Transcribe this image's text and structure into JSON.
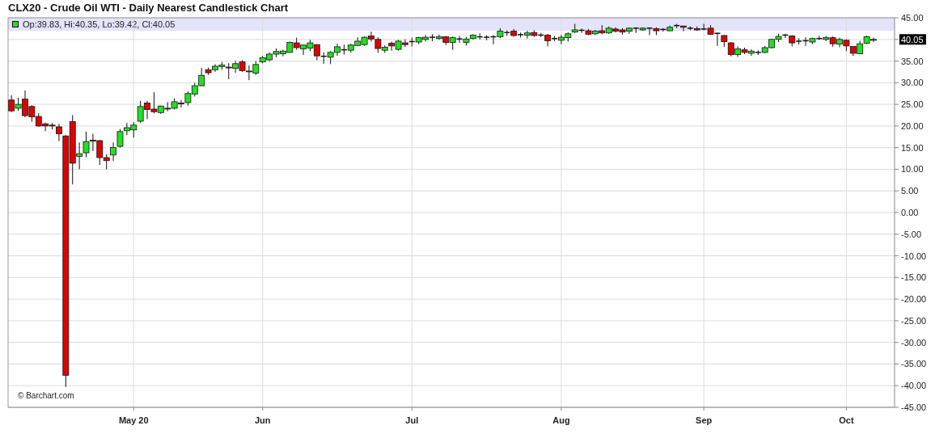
{
  "chart": {
    "title": "CLX20 - Crude Oil WTI - Daily Nearest Candlestick Chart",
    "legend": {
      "text": "Op:39.83, Hi:40.35, Lo:39.42, Cl:40.05"
    },
    "last_price_label": "40.05",
    "credit": "© Barchart.com",
    "chart_data": {
      "type": "candlestick",
      "grid": true,
      "ylim": [
        -45,
        45
      ],
      "yticks": [
        {
          "value": 45,
          "label": "45.00"
        },
        {
          "value": 35,
          "label": "35.00"
        },
        {
          "value": 30,
          "label": "30.00"
        },
        {
          "value": 25,
          "label": "25.00"
        },
        {
          "value": 20,
          "label": "20.00"
        },
        {
          "value": 15,
          "label": "15.00"
        },
        {
          "value": 10,
          "label": "10.00"
        },
        {
          "value": 5,
          "label": "5.00"
        },
        {
          "value": 0,
          "label": "0.00"
        },
        {
          "value": -5,
          "label": "-5.00"
        },
        {
          "value": -10,
          "label": "-10.00"
        },
        {
          "value": -15,
          "label": "-15.00"
        },
        {
          "value": -20,
          "label": "-20.00"
        },
        {
          "value": -25,
          "label": "-25.00"
        },
        {
          "value": -30,
          "label": "-30.00"
        },
        {
          "value": -35,
          "label": "-35.00"
        },
        {
          "value": -40,
          "label": "-40.00"
        },
        {
          "value": -45,
          "label": "-45.00"
        }
      ],
      "categories": [
        null,
        null,
        null,
        null,
        null,
        null,
        null,
        null,
        null,
        null,
        null,
        null,
        null,
        null,
        null,
        null,
        null,
        null,
        "May 20",
        null,
        null,
        null,
        null,
        null,
        null,
        null,
        null,
        null,
        null,
        null,
        null,
        null,
        null,
        null,
        null,
        null,
        null,
        "Jun",
        null,
        null,
        null,
        null,
        null,
        null,
        null,
        null,
        null,
        null,
        null,
        null,
        null,
        null,
        null,
        null,
        null,
        null,
        null,
        null,
        null,
        "Jul",
        null,
        null,
        null,
        null,
        null,
        null,
        null,
        null,
        null,
        null,
        null,
        null,
        null,
        null,
        null,
        null,
        null,
        null,
        null,
        null,
        null,
        "Aug",
        null,
        null,
        null,
        null,
        null,
        null,
        null,
        null,
        null,
        null,
        null,
        null,
        null,
        null,
        null,
        null,
        null,
        null,
        null,
        null,
        "Sep",
        null,
        null,
        null,
        null,
        null,
        null,
        null,
        null,
        null,
        null,
        null,
        null,
        null,
        null,
        null,
        null,
        null,
        null,
        null,
        null,
        "Oct",
        null,
        null,
        null,
        null
      ],
      "ohlc": [
        [
          26,
          27.1,
          23.2,
          23.5
        ],
        [
          24.1,
          26.5,
          23.5,
          25
        ],
        [
          26.2,
          28.2,
          22,
          22.4
        ],
        [
          24.5,
          24.8,
          21,
          22.1
        ],
        [
          22.2,
          23,
          19.8,
          20
        ],
        [
          20.5,
          20.8,
          18.8,
          20
        ],
        [
          20.2,
          20.7,
          19.2,
          20
        ],
        [
          19.8,
          20.5,
          16.5,
          18.2
        ],
        [
          17.7,
          17.9,
          -40.3,
          -37.6
        ],
        [
          21,
          22.5,
          6.5,
          11.4
        ],
        [
          13,
          16.2,
          10,
          13.6
        ],
        [
          13.8,
          18.7,
          12.8,
          16.4
        ],
        [
          16.7,
          18.2,
          14.2,
          16.5
        ],
        [
          16.6,
          16.8,
          11,
          12.7
        ],
        [
          12.7,
          13.5,
          10,
          12
        ],
        [
          13.3,
          16.2,
          11.9,
          15
        ],
        [
          15.3,
          19.3,
          15,
          18.7
        ],
        [
          18.9,
          20.7,
          17.9,
          19.6
        ],
        [
          19.1,
          20.9,
          17.3,
          20.2
        ],
        [
          21.1,
          25.8,
          20.7,
          24.5
        ],
        [
          25.3,
          25.8,
          21.6,
          23.8
        ],
        [
          23.9,
          27.8,
          22.9,
          23.3
        ],
        [
          23.1,
          24.7,
          22.8,
          24.6
        ],
        [
          24.1,
          25.5,
          23.4,
          24
        ],
        [
          24.1,
          26.4,
          23.8,
          25.6
        ],
        [
          25.3,
          26,
          24.3,
          25.2
        ],
        [
          25.4,
          28,
          24.7,
          27.5
        ],
        [
          27.4,
          30,
          26.8,
          29.3
        ],
        [
          29.3,
          33.4,
          29.2,
          31.7
        ],
        [
          33,
          33.5,
          31.8,
          32.3
        ],
        [
          33,
          34.3,
          32.5,
          33.8
        ],
        [
          33.7,
          34.8,
          33,
          34.1
        ],
        [
          33.6,
          34.5,
          30.8,
          33.5
        ],
        [
          33.3,
          35,
          32.3,
          34.4
        ],
        [
          34.8,
          35.2,
          32.5,
          32.8
        ],
        [
          32.6,
          34,
          30.6,
          32.7
        ],
        [
          32.2,
          35,
          31.8,
          34.2
        ],
        [
          34.8,
          36.2,
          34.5,
          35.8
        ],
        [
          35.3,
          37,
          34.9,
          36.6
        ],
        [
          36.6,
          37.9,
          35.9,
          37.2
        ],
        [
          36.7,
          37.6,
          36.1,
          37.3
        ],
        [
          37,
          39.5,
          36.9,
          39.3
        ],
        [
          39.2,
          40.4,
          37.6,
          38.1
        ],
        [
          37.8,
          38.8,
          36.4,
          38.7
        ],
        [
          38,
          39.9,
          37.3,
          39.2
        ],
        [
          38.8,
          38.9,
          35.2,
          36.2
        ],
        [
          36.1,
          37,
          34.4,
          36.1
        ],
        [
          35.9,
          37.3,
          34.3,
          37
        ],
        [
          37,
          39,
          36.2,
          38.3
        ],
        [
          37.6,
          38.8,
          36.5,
          37.6
        ],
        [
          37.5,
          39,
          37,
          38.7
        ],
        [
          38.6,
          40.5,
          38.5,
          39.6
        ],
        [
          38.8,
          40.7,
          38.5,
          40.5
        ],
        [
          40.8,
          41.8,
          39.5,
          40.1
        ],
        [
          40,
          40.5,
          36.9,
          37.9
        ],
        [
          37.5,
          38.6,
          36.9,
          38.2
        ],
        [
          39.1,
          39.5,
          37.4,
          38.5
        ],
        [
          37.7,
          39.9,
          37.4,
          39.6
        ],
        [
          39.2,
          40,
          38.2,
          38.8
        ],
        [
          39.5,
          40.4,
          38.4,
          39.5
        ],
        [
          39.4,
          40.6,
          38.9,
          40.4
        ],
        [
          40,
          41,
          39.5,
          40.5
        ],
        [
          40.5,
          41.2,
          39.6,
          40.5
        ],
        [
          40.2,
          41.1,
          39.9,
          40.6
        ],
        [
          40.6,
          40.8,
          38.7,
          39.3
        ],
        [
          39.3,
          40.7,
          37.6,
          40.4
        ],
        [
          40.1,
          40.8,
          39.2,
          40.1
        ],
        [
          39.3,
          40.6,
          38.6,
          40.1
        ],
        [
          40.2,
          41.2,
          40,
          41
        ],
        [
          40.6,
          41.4,
          40,
          40.6
        ],
        [
          40.5,
          41,
          39.8,
          40.5
        ],
        [
          40.6,
          41,
          38.9,
          40.6
        ],
        [
          40.6,
          42.6,
          40.3,
          41.9
        ],
        [
          41.6,
          42.1,
          40.8,
          41.6
        ],
        [
          41.9,
          42.4,
          40.6,
          40.9
        ],
        [
          41.1,
          41.6,
          40.4,
          41.1
        ],
        [
          41,
          42,
          40.2,
          41.5
        ],
        [
          41.6,
          42.1,
          40.6,
          40.9
        ],
        [
          41,
          41.5,
          40.5,
          41
        ],
        [
          41,
          41.3,
          38.4,
          39.7
        ],
        [
          40.2,
          40.8,
          39.6,
          40.2
        ],
        [
          39.8,
          41,
          38.9,
          40.5
        ],
        [
          40.4,
          41.6,
          39.5,
          41.3
        ],
        [
          41.7,
          43.6,
          41.5,
          42.2
        ],
        [
          42.1,
          42.5,
          41.5,
          42.1
        ],
        [
          42,
          42.4,
          41,
          41.2
        ],
        [
          41.3,
          42.2,
          41,
          41.9
        ],
        [
          42,
          43.3,
          41.2,
          41.5
        ],
        [
          41.5,
          43,
          41.3,
          42.6
        ],
        [
          42.4,
          42.8,
          41.6,
          41.9
        ],
        [
          42.2,
          42.6,
          41.1,
          41.7
        ],
        [
          41.9,
          42.8,
          41.3,
          42.6
        ],
        [
          42.6,
          42.8,
          41.5,
          42.6
        ],
        [
          42.2,
          42.8,
          42,
          42.6
        ],
        [
          42.6,
          42.8,
          41,
          42.6
        ],
        [
          42.5,
          42.8,
          41,
          42
        ],
        [
          42.3,
          42.6,
          41.8,
          42.3
        ],
        [
          42,
          43.2,
          41.9,
          42.8
        ],
        [
          43.2,
          43.6,
          42.6,
          43.2
        ],
        [
          43.1,
          43.1,
          41.9,
          42.8
        ],
        [
          42.6,
          43,
          42.1,
          42.6
        ],
        [
          42.5,
          43,
          42,
          42.2
        ],
        [
          42.4,
          43.6,
          42.1,
          42.4
        ],
        [
          42.6,
          43.3,
          41,
          41.2
        ],
        [
          41.4,
          41.6,
          38.5,
          41.4
        ],
        [
          40.9,
          41,
          38.3,
          39.5
        ],
        [
          39.2,
          39.4,
          36.1,
          36.5
        ],
        [
          36.5,
          38.4,
          36,
          37.8
        ],
        [
          37.6,
          38.1,
          36.6,
          37
        ],
        [
          36.8,
          37.7,
          36.2,
          37.3
        ],
        [
          37,
          37.5,
          36.4,
          37
        ],
        [
          37,
          38.5,
          36.8,
          38.1
        ],
        [
          38.1,
          40.1,
          37.9,
          40
        ],
        [
          40,
          41.3,
          39.4,
          40.7
        ],
        [
          41,
          41.3,
          40.3,
          41
        ],
        [
          40.8,
          41,
          38.4,
          39.2
        ],
        [
          39.6,
          40.3,
          38.8,
          39.6
        ],
        [
          39.7,
          40.5,
          38.5,
          39.7
        ],
        [
          39.4,
          40.4,
          38.9,
          40.2
        ],
        [
          40.2,
          40.8,
          39.9,
          40.2
        ],
        [
          40,
          40.8,
          39.6,
          40.4
        ],
        [
          40.4,
          40.7,
          38.3,
          39
        ],
        [
          38.9,
          40.4,
          38.2,
          40
        ],
        [
          39.8,
          40,
          37.3,
          38.5
        ],
        [
          38.4,
          38.4,
          36.2,
          36.8
        ],
        [
          36.7,
          39.7,
          36.6,
          39
        ],
        [
          39.1,
          40.9,
          38.9,
          40.6
        ],
        [
          39.8,
          40.4,
          39.4,
          40
        ]
      ]
    }
  }
}
